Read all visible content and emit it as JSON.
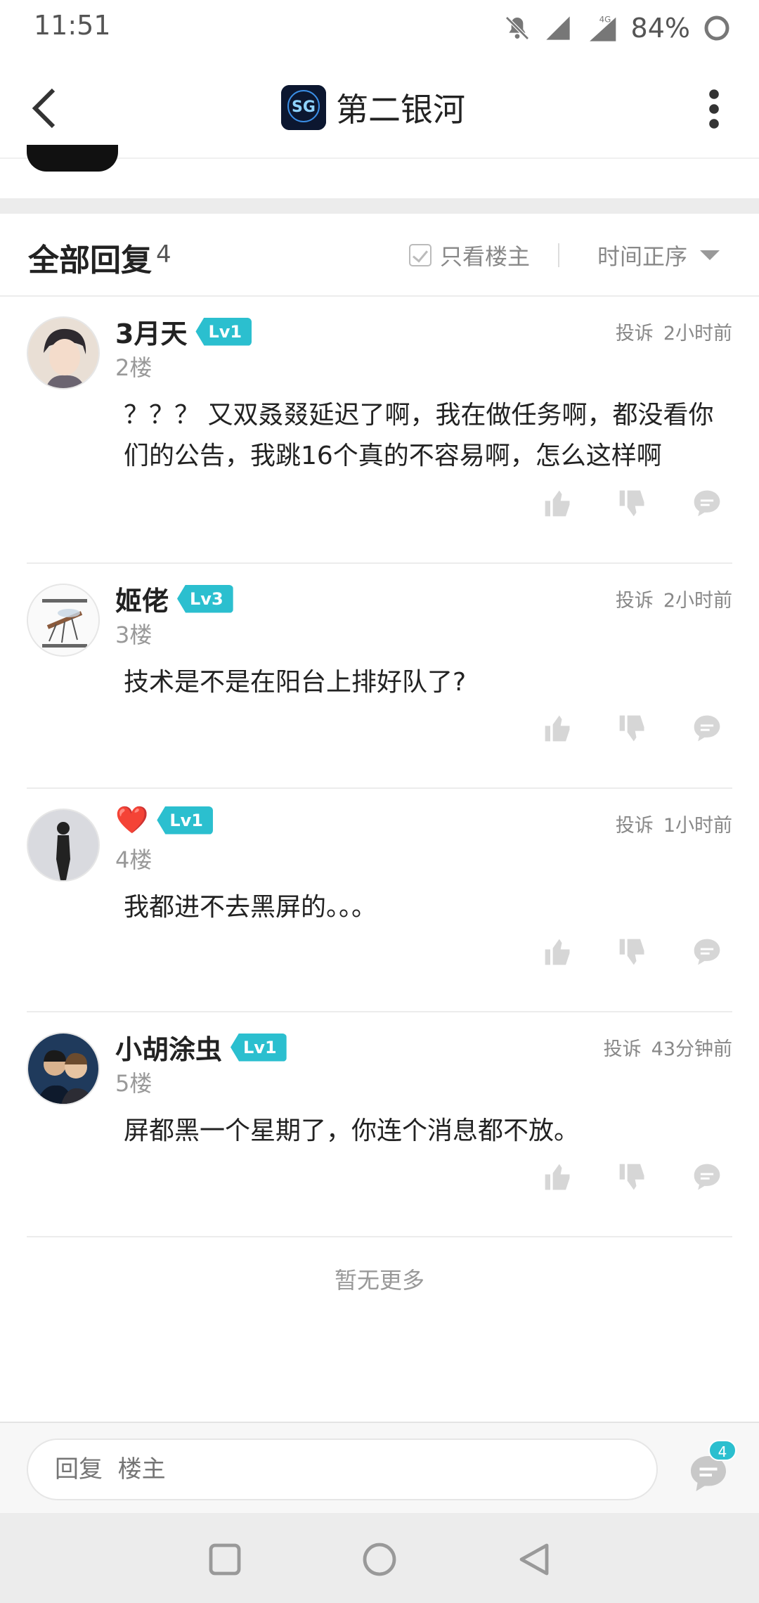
{
  "status_bar": {
    "time": "11:51",
    "battery": "84%",
    "network": "4G"
  },
  "header": {
    "title": "第二银河",
    "logo_text": "SG"
  },
  "replies": {
    "title": "全部回复",
    "count": "4",
    "op_only_label": "只看楼主",
    "sort_label": "时间正序"
  },
  "posts": [
    {
      "username": "3月天",
      "level": "Lv1",
      "floor": "2楼",
      "report": "投诉",
      "time": "2小时前",
      "line1": "？？？ 又双叒叕延迟了啊，我在做任务啊，都没看你",
      "line2": "们的公告，我跳16个真的不容易啊，怎么这样啊"
    },
    {
      "username": "姬佬",
      "level": "Lv3",
      "floor": "3楼",
      "report": "投诉",
      "time": "2小时前",
      "line1": "技术是不是在阳台上排好队了?"
    },
    {
      "username": "❤️",
      "level": "Lv1",
      "floor": "4楼",
      "report": "投诉",
      "time": "1小时前",
      "line1": "我都进不去黑屏的。。。"
    },
    {
      "username": "小胡涂虫",
      "level": "Lv1",
      "floor": "5楼",
      "report": "投诉",
      "time": "43分钟前",
      "line1": "屏都黑一个星期了，你连个消息都不放。"
    }
  ],
  "no_more": "暂无更多",
  "reply_bar": {
    "placeholder": "回复  楼主",
    "comment_badge": "4"
  },
  "colors": {
    "accent": "#2bbfcf",
    "text": "#222222",
    "muted": "#999999",
    "icon": "#d9d9d9"
  }
}
